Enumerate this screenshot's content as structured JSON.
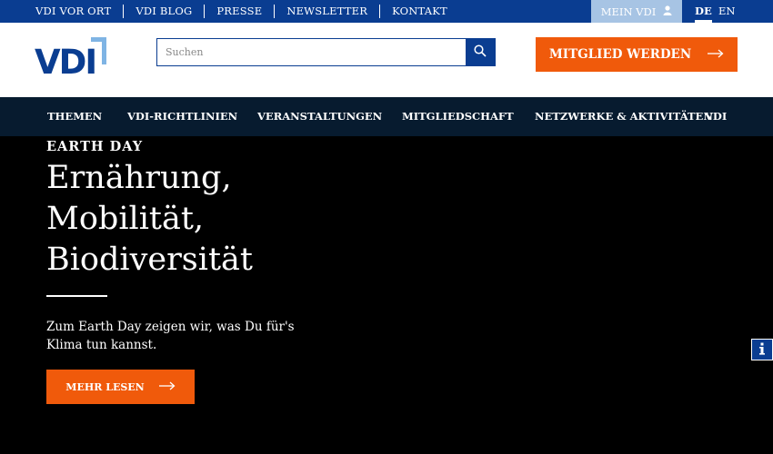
{
  "topbar": {
    "links": [
      "VDI VOR ORT",
      "VDI BLOG",
      "PRESSE",
      "NEWSLETTER",
      "KONTAKT"
    ],
    "mein_vdi": "MEIN VDI",
    "languages": {
      "de": "DE",
      "en": "EN"
    }
  },
  "header": {
    "logo_text": "VDI",
    "search_placeholder": "Suchen",
    "search_value": "",
    "cta_label": "MITGLIED WERDEN"
  },
  "nav": {
    "items": [
      "THEMEN",
      "VDI-RICHTLINIEN",
      "VERANSTALTUNGEN",
      "MITGLIEDSCHAFT",
      "NETZWERKE & AKTIVITÄTEN",
      "VDI"
    ]
  },
  "hero": {
    "eyebrow": "EARTH DAY",
    "headline_lines": [
      "Ernährung,",
      "Mobilität,",
      "Biodiversität"
    ],
    "teaser": "Zum Earth Day zeigen wir, was Du für's Klima tun kannst.",
    "button_label": "MEHR LESEN"
  },
  "colors": {
    "brand_blue": "#0a3d91",
    "light_blue": "#a7c4e4",
    "accent_orange": "#f05a0b",
    "nav_dark": "#071b2f"
  },
  "icons": {
    "search": "search-icon",
    "user": "user-icon",
    "arrow": "arrow-right-icon",
    "info": "info-icon"
  }
}
